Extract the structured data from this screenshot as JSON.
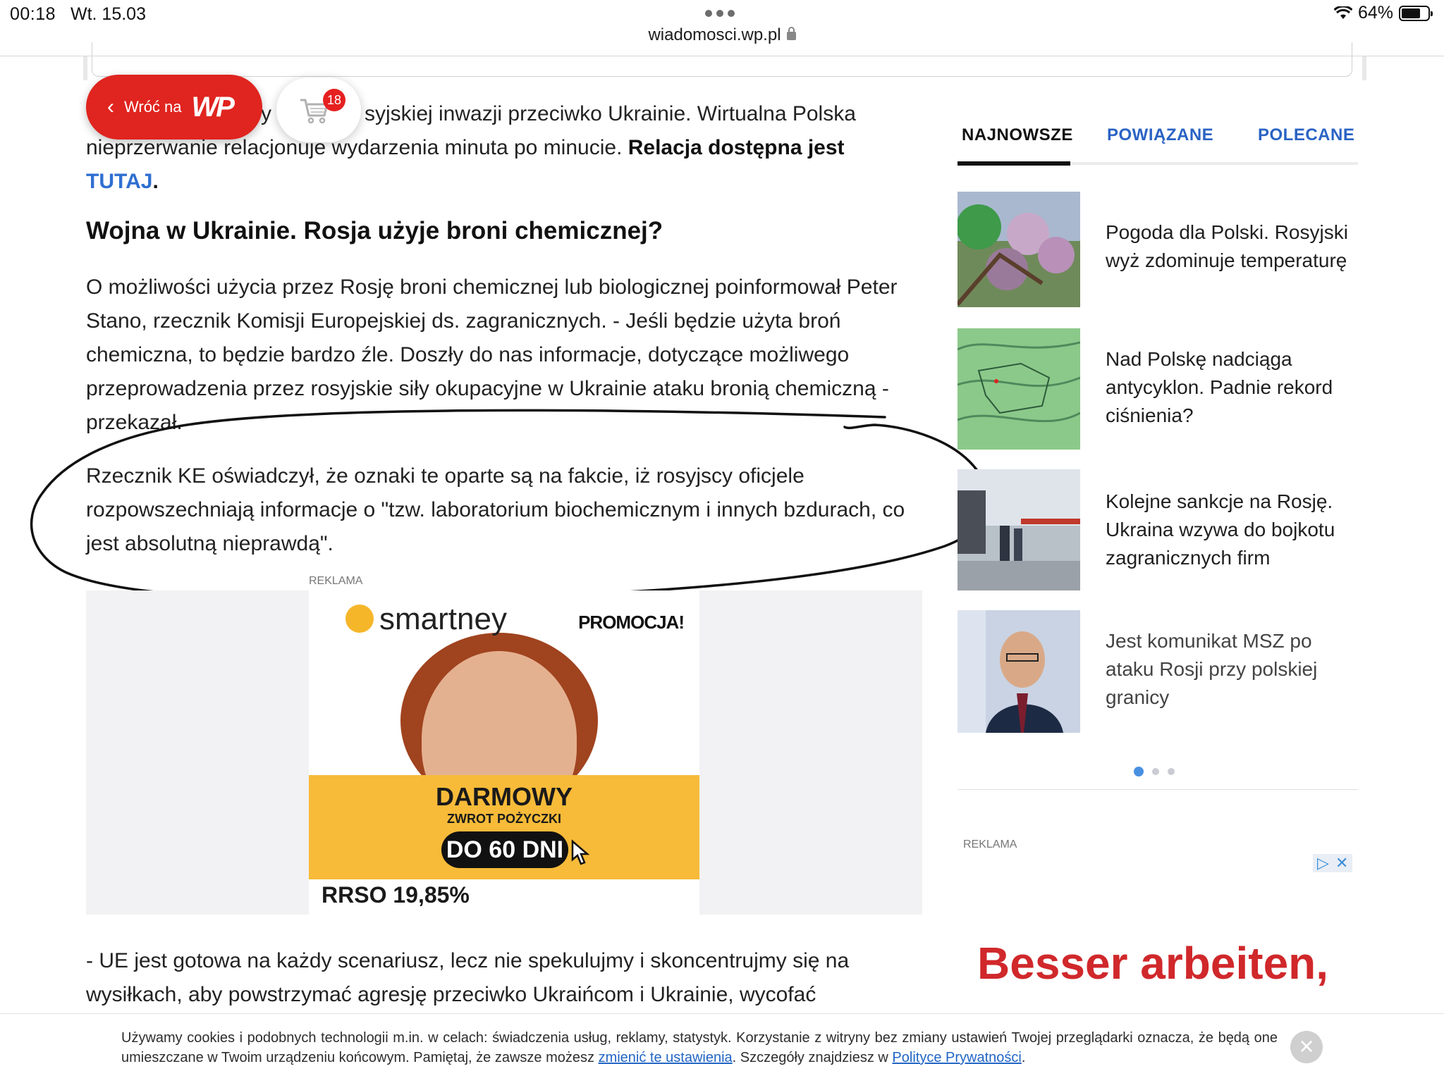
{
  "status_bar": {
    "time": "00:18",
    "date": "Wt. 15.03",
    "battery": "64%",
    "url": "wiadomosci.wp.pl"
  },
  "floating": {
    "back_label": "Wróć na",
    "back_brand": "WP",
    "cart_badge": "18"
  },
  "article": {
    "intro_line1": "y",
    "intro_line1b": "syjskiej inwazji przeciwko Ukrainie. Wirtualna Polska",
    "intro_line2_plain": "nieprzerwanie relacjonuje wydarzenia minuta po minucie. ",
    "intro_line2_bold": "Relacja dostępna jest",
    "intro_link": "TUTAJ",
    "intro_dot": ".",
    "heading": "Wojna w Ukrainie. Rosja użyje broni chemicznej?",
    "para1": "O możliwości użycia przez Rosję broni chemicznej lub biologicznej poinformował Peter Stano, rzecznik Komisji Europejskiej ds. zagranicznych. - Jeśli będzie użyta broń chemiczna, to będzie bardzo źle. Doszły do nas informacje, dotyczące możliwego przeprowadzenia przez rosyjskie siły okupacyjne w Ukrainie ataku bronią chemiczną - przekazał.",
    "para2": "Rzecznik KE oświadczył, że oznaki te oparte są na fakcie, iż rosyjscy oficjele rozpowszechniają informacje o \"tzw. laboratorium biochemicznym i innych bzdurach, co jest absolutną nieprawdą\".",
    "para3": "- UE jest gotowa na każdy scenariusz, lecz nie spekulujmy i skoncentrujmy się na wysiłkach, aby powstrzymać agresję przeciwko Ukraińcom i Ukrainie, wycofać"
  },
  "ad_main": {
    "label": "REKLAMA",
    "brand": "smartney",
    "promo": "PROMOCJA!",
    "headline": "DARMOWY",
    "subline": "ZWROT POŻYCZKI",
    "pill": "DO 60 DNI",
    "rrso": "RRSO 19,85%"
  },
  "sidebar": {
    "tabs": [
      "NAJNOWSZE",
      "POWIĄZANE",
      "POLECANE"
    ],
    "news": [
      {
        "title": "Pogoda dla Polski. Rosyjski wyż zdominuje temperaturę"
      },
      {
        "title": "Nad Polskę nadciąga antycyklon. Padnie rekord ciśnienia?"
      },
      {
        "title": "Kolejne sankcje na Rosję. Ukraina wzywa do bojkotu zagranicznych firm"
      },
      {
        "title": "Jest komunikat MSZ po ataku Rosji przy polskiej granicy"
      }
    ],
    "ad_label": "REKLAMA",
    "ad_text": "Besser arbeiten,"
  },
  "cookie": {
    "text_before": "Używamy cookies i podobnych technologii m.in. w celach: świadczenia usług, reklamy, statystyk. Korzystanie z witryny bez zmiany ustawień Twojej przeglądarki oznacza, że będą one umieszczane w Twoim urządzeniu końcowym. Pamiętaj, że zawsze możesz ",
    "link1": "zmienić te ustawienia",
    "text_mid": ". Szczegóły znajdziesz w ",
    "link2": "Polityce Prywatności",
    "text_after": "."
  },
  "colors": {
    "wp_red": "#e0241f",
    "link_blue": "#2f6fd1",
    "tab_blue": "#2a63c4",
    "ad_yellow": "#f7bb39",
    "besser_red": "#d0282b"
  }
}
